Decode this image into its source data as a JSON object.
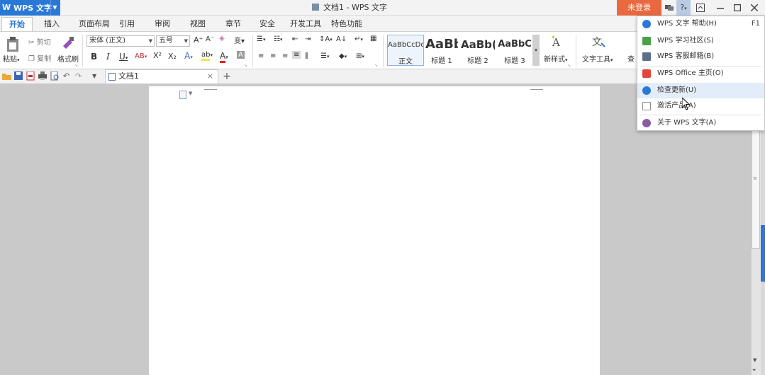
{
  "titlebar": {
    "app_name": "WPS 文字",
    "doc_title": "文档1 - WPS 文字",
    "login_label": "未登录",
    "help_label": "?"
  },
  "tabs": [
    {
      "label": "开始",
      "active": true
    },
    {
      "label": "插入"
    },
    {
      "label": "页面布局"
    },
    {
      "label": "引用"
    },
    {
      "label": "审阅"
    },
    {
      "label": "视图"
    },
    {
      "label": "章节"
    },
    {
      "label": "安全"
    },
    {
      "label": "开发工具"
    },
    {
      "label": "特色功能"
    }
  ],
  "ribbon": {
    "paste_label": "粘贴",
    "cut_label": "剪切",
    "copy_label": "复制",
    "format_painter_label": "格式刷",
    "font_name": "宋体 (正文)",
    "font_size": "五号",
    "styles": [
      {
        "sample": "AaBbCcDd",
        "label": "正文"
      },
      {
        "sample": "AaBb",
        "label": "标题 1"
      },
      {
        "sample": "AaBb(",
        "label": "标题 2"
      },
      {
        "sample": "AaBbC",
        "label": "标题 3"
      }
    ],
    "new_style_label": "新样式",
    "text_tools_label": "文字工具",
    "find_label": "查"
  },
  "doc_tabs": [
    {
      "label": "文档1"
    }
  ],
  "help_menu": {
    "items": [
      {
        "label": "WPS 文字 帮助(H)",
        "shortcut": "F1",
        "icon": "help-icon",
        "color": "#2a78d6"
      },
      {
        "label": "WPS 学习社区(S)",
        "icon": "book-icon",
        "color": "#4aa14a"
      },
      {
        "label": "WPS 客服邮箱(B)",
        "icon": "mail-icon",
        "color": "#5c6f86"
      },
      {
        "label": "WPS Office 主页(O)",
        "icon": "wps-logo-icon",
        "color": "#e0463c"
      },
      {
        "label": "检查更新(U)",
        "icon": "update-icon",
        "color": "#2a78d6",
        "highlighted": true
      },
      {
        "label": "激活产品(A)",
        "icon": "activate-icon",
        "color": "#8a8a8a"
      },
      {
        "label": "关于 WPS 文字(A)",
        "icon": "info-icon",
        "color": "#8b5aa8"
      }
    ]
  },
  "colors": {
    "accent": "#2a78d6",
    "login": "#e9683f",
    "workspace": "#c9c9c9"
  }
}
